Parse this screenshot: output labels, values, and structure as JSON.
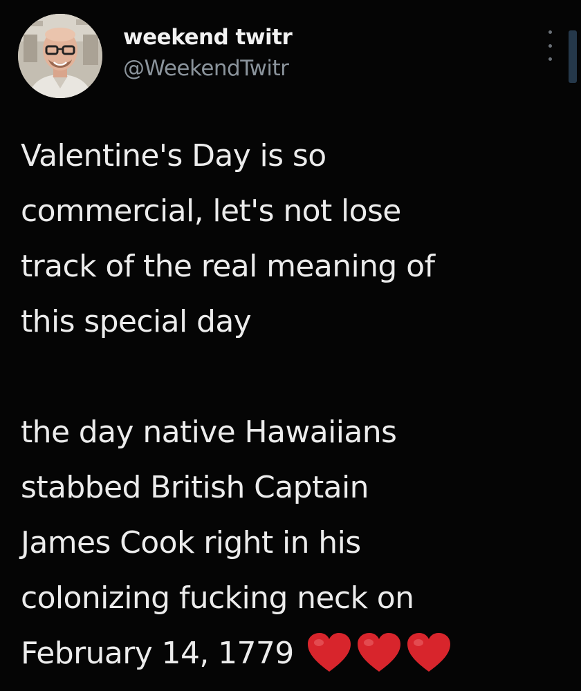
{
  "author": {
    "display_name": "weekend twitr",
    "handle": "@WeekendTwitr"
  },
  "tweet": {
    "paragraph_1": [
      "Valentine's Day is so",
      "commercial, let's not lose",
      "track of the real meaning of",
      "this special day"
    ],
    "paragraph_2": [
      "the day native Hawaiians",
      "stabbed British Captain",
      "James Cook right in his",
      "colonizing fucking neck on",
      "February 14, 1779"
    ],
    "emoji": [
      "red-heart",
      "red-heart",
      "red-heart"
    ]
  },
  "colors": {
    "background": "#050505",
    "text": "#ececec",
    "handle": "#8b949c",
    "heart": "#d8252c"
  }
}
